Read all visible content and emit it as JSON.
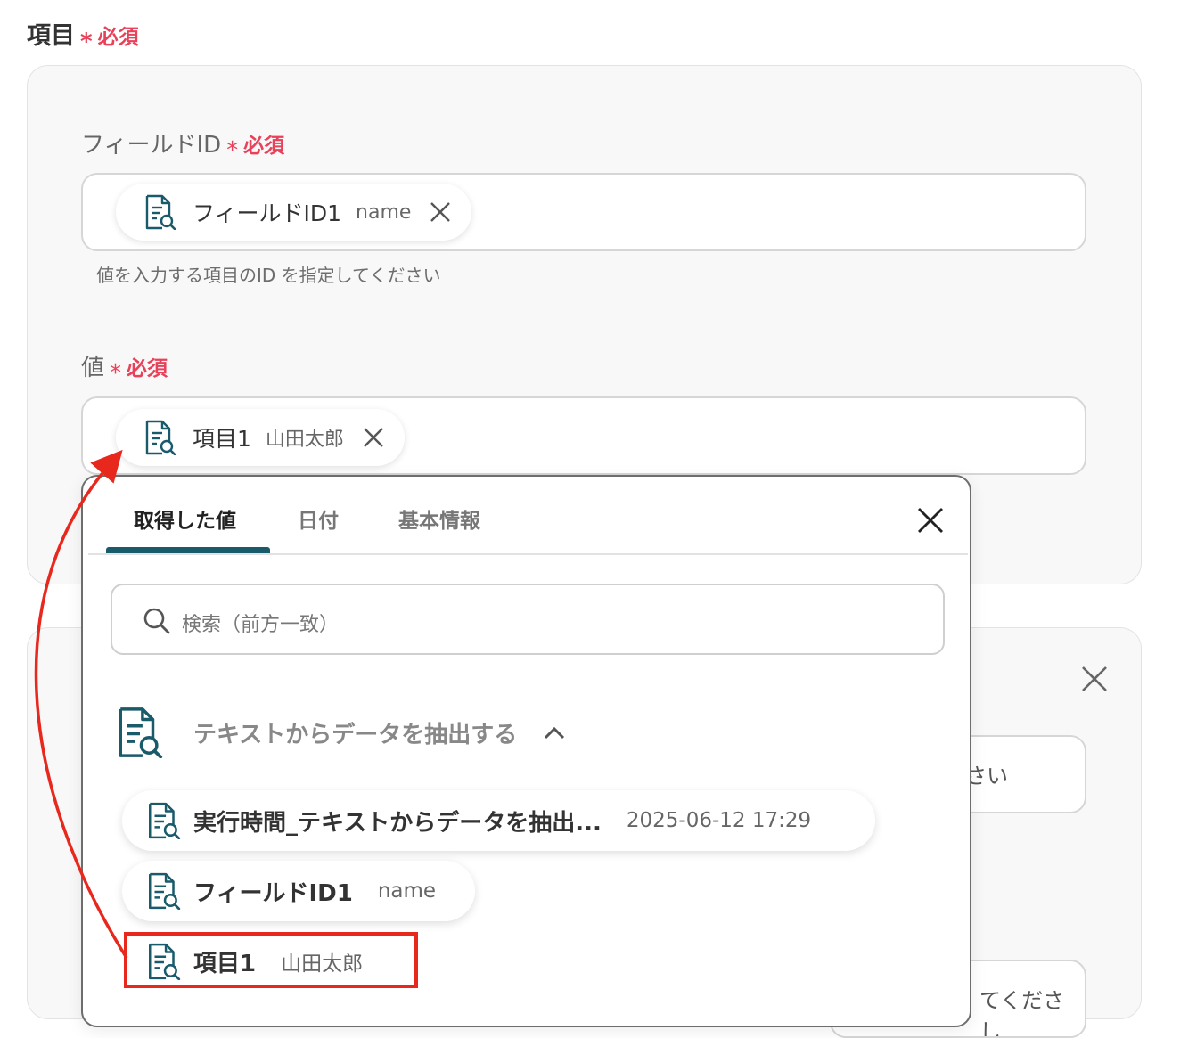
{
  "section": {
    "label": "項目",
    "required": "必須"
  },
  "field_id": {
    "label": "フィールドID",
    "required": "必須",
    "chip": {
      "title": "フィールドID1",
      "sub": "name"
    },
    "hint": "値を入力する項目のID を指定してください"
  },
  "value_field": {
    "label": "値",
    "required": "必須",
    "chip": {
      "title": "項目1",
      "sub": "山田太郎"
    }
  },
  "panel2": {
    "partial_text_1": "さい",
    "partial_text_2": "てくださし"
  },
  "dropdown": {
    "tabs": [
      "取得した値",
      "日付",
      "基本情報"
    ],
    "active_tab": "取得した値",
    "search_placeholder": "検索（前方一致）",
    "group_title": "テキストからデータを抽出する",
    "items": [
      {
        "title": "実行時間_テキストからデータを抽出...",
        "sub": "2025-06-12 17:29"
      },
      {
        "title": "フィールドID1",
        "sub": "name"
      },
      {
        "title": "項目1",
        "sub": "山田太郎"
      }
    ]
  },
  "colors": {
    "required": "#e8415a",
    "accent": "#1a5b6b",
    "annotation": "#e8281d"
  }
}
